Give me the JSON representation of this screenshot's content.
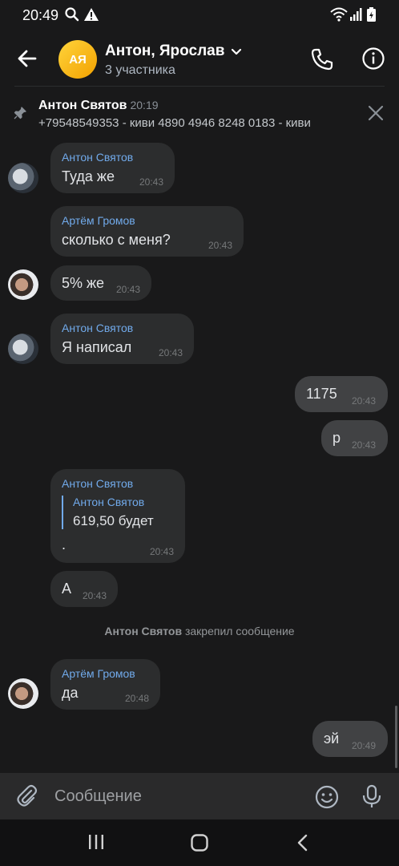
{
  "status_bar": {
    "time": "20:49",
    "icons": [
      "search-icon",
      "warning-icon",
      "wifi-icon",
      "signal-icon",
      "battery-icon"
    ]
  },
  "header": {
    "avatar_initials": "АЯ",
    "title": "Антон, Ярослав",
    "subtitle": "3 участника",
    "accent_color": "#71aaeb"
  },
  "pinned": {
    "author": "Антон Святов",
    "time": "20:19",
    "text": "+79548549353 - киви 4890 4946 8248 0183 - киви"
  },
  "messages": [
    {
      "sender": "Антон Святов",
      "text": "Туда же",
      "time": "20:43"
    },
    {
      "sender": "Артём Громов",
      "text": "сколько с меня?",
      "time": "20:43"
    },
    {
      "text": "5% же",
      "time": "20:43"
    },
    {
      "sender": "Антон Святов",
      "text": "Я написал",
      "time": "20:43"
    },
    {
      "text": "1175",
      "time": "20:43"
    },
    {
      "text": "р",
      "time": "20:43"
    },
    {
      "sender": "Антон Святов",
      "reply_author": "Антон Святов",
      "reply_text": "619,50 будет",
      "text": ".",
      "time": "20:43"
    },
    {
      "text": "А",
      "time": "20:43"
    },
    {
      "sender": "Артём Громов",
      "text": "да",
      "time": "20:48"
    },
    {
      "text": "эй",
      "time": "20:49"
    }
  ],
  "system_message": {
    "actor": "Антон Святов",
    "action": "закрепил сообщение"
  },
  "composer": {
    "placeholder": "Сообщение"
  }
}
